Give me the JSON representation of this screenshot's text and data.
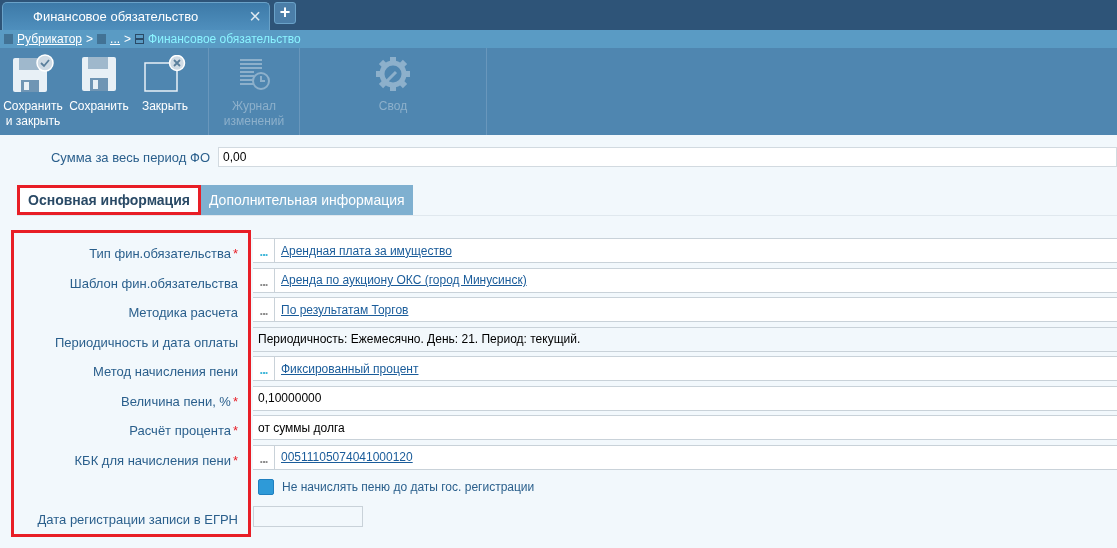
{
  "tabs": [
    {
      "label": "Финансовое обязательство",
      "selected": true,
      "close": "×"
    }
  ],
  "new_tab": "+",
  "breadcrumb": [
    {
      "label": "Рубрикатор",
      "kind": "link"
    },
    {
      "label": "...",
      "kind": "link"
    },
    {
      "label": "Финансовое обязательство",
      "kind": "current"
    }
  ],
  "breadcrumb_separator": ">",
  "toolbar": [
    {
      "label": "Сохранить и закрыть",
      "disabled": false
    },
    {
      "label": "Сохранить",
      "disabled": false
    },
    {
      "label": "Закрыть",
      "disabled": false
    },
    {
      "label": "Журнал изменений",
      "disabled": true
    },
    {
      "label": "Свод",
      "disabled": true
    }
  ],
  "summary_field": {
    "label": "Сумма за весь период ФО",
    "value": "0,00"
  },
  "form_tabs": [
    {
      "label": "Основная информация",
      "selected": true,
      "highlighted": true
    },
    {
      "label": "Дополнительная информация",
      "selected": false,
      "highlighted": false
    }
  ],
  "fields": [
    {
      "label": "Тип фин.обязательства",
      "required": true,
      "kind": "lookup",
      "value": "Арендная плата за имущество",
      "dots_active": true
    },
    {
      "label": "Шаблон фин.обязательства",
      "required": false,
      "kind": "lookup",
      "value": "Аренда по аукциону ОКС (город Минусинск)",
      "dots_active": false
    },
    {
      "label": "Методика расчета",
      "required": false,
      "kind": "lookup",
      "value": "По результатам Торгов",
      "dots_active": false
    },
    {
      "label": "Периодичность и дата оплаты",
      "required": false,
      "kind": "readonly",
      "value": "Периодичность: Ежемесячно. День: 21. Период: текущий."
    },
    {
      "label": "Метод начисления пени",
      "required": false,
      "kind": "lookup",
      "value": "Фиксированный процент",
      "dots_active": true
    },
    {
      "label": "Величина пени, %",
      "required": true,
      "kind": "text",
      "value": "0,10000000"
    },
    {
      "label": "Расчёт процента",
      "required": true,
      "kind": "text",
      "value": "от суммы долга"
    },
    {
      "label": "КБК для начисления пени",
      "required": true,
      "kind": "lookup",
      "value": "00511105074041000120",
      "dots_active": false
    },
    {
      "kind": "checkbox",
      "value": "Не начислять пеню до даты гос. регистрации",
      "checked": false
    },
    {
      "label": "Дата регистрации записи в ЕГРН",
      "required": false,
      "kind": "date"
    }
  ],
  "required_mark": "*",
  "dots": "...",
  "fields_highlighted": true
}
